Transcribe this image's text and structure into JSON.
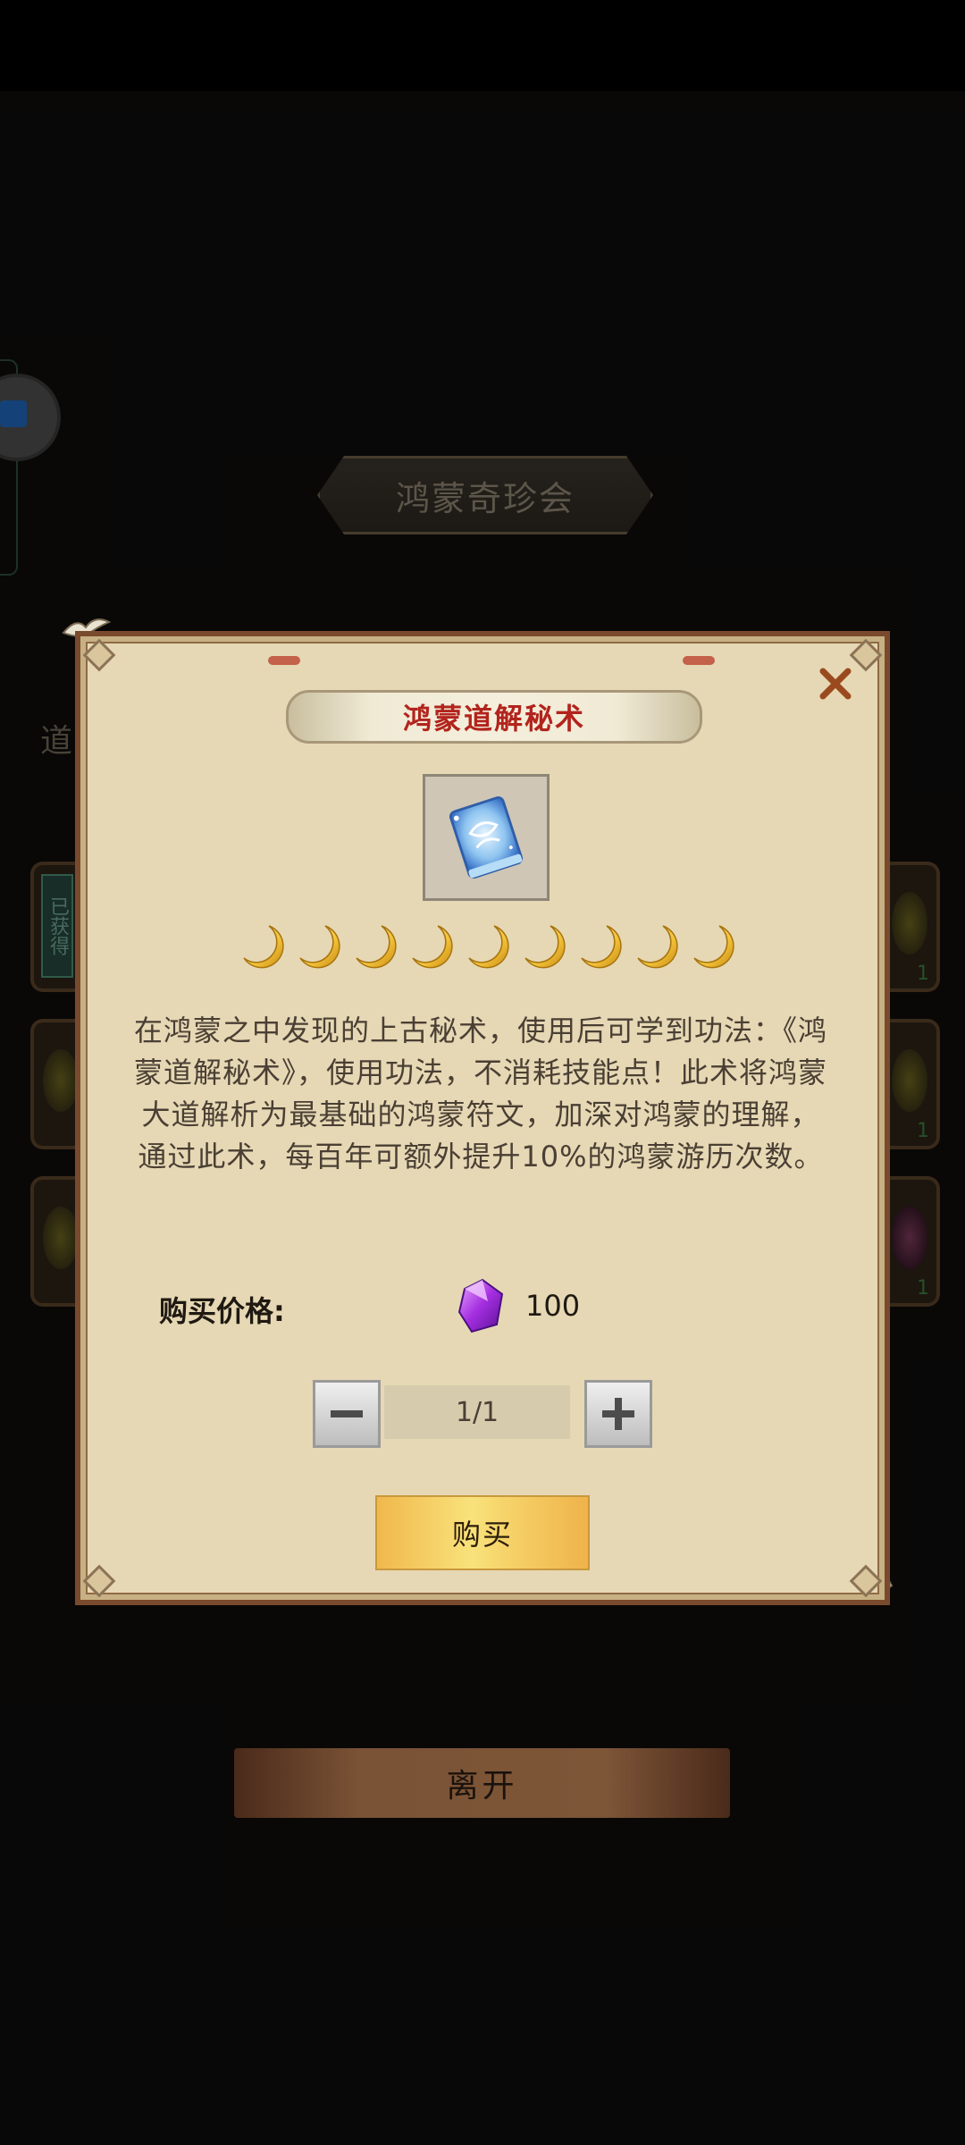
{
  "background": {
    "shop_title": "鸿蒙奇珍会",
    "left_label": "道",
    "obtained_badge": "已获得",
    "right_counts": [
      "1",
      "1",
      "1"
    ]
  },
  "dialog": {
    "item_name": "鸿蒙道解秘术",
    "star_count": 9,
    "description": "在鸿蒙之中发现的上古秘术，使用后可学到功法：《鸿蒙道解秘术》，使用功法，不消耗技能点！此术将鸿蒙大道解析为最基础的鸿蒙符文，加深对鸿蒙的理解，通过此术，每百年可额外提升10%的鸿蒙游历次数。",
    "price_label": "购买价格:",
    "price_value": "100",
    "quantity": "1/1",
    "buy_label": "购买",
    "icons": {
      "close": "close-icon",
      "currency": "purple-gem-icon",
      "item": "spell-book-icon",
      "star": "crescent-moon-icon"
    }
  },
  "footer": {
    "leave_label": "离开"
  },
  "colors": {
    "dialog_bg": "#e6d8b4",
    "title_red": "#b2241d",
    "buy_gold": "#f6d46a",
    "close_brown": "#9b4a1f"
  }
}
